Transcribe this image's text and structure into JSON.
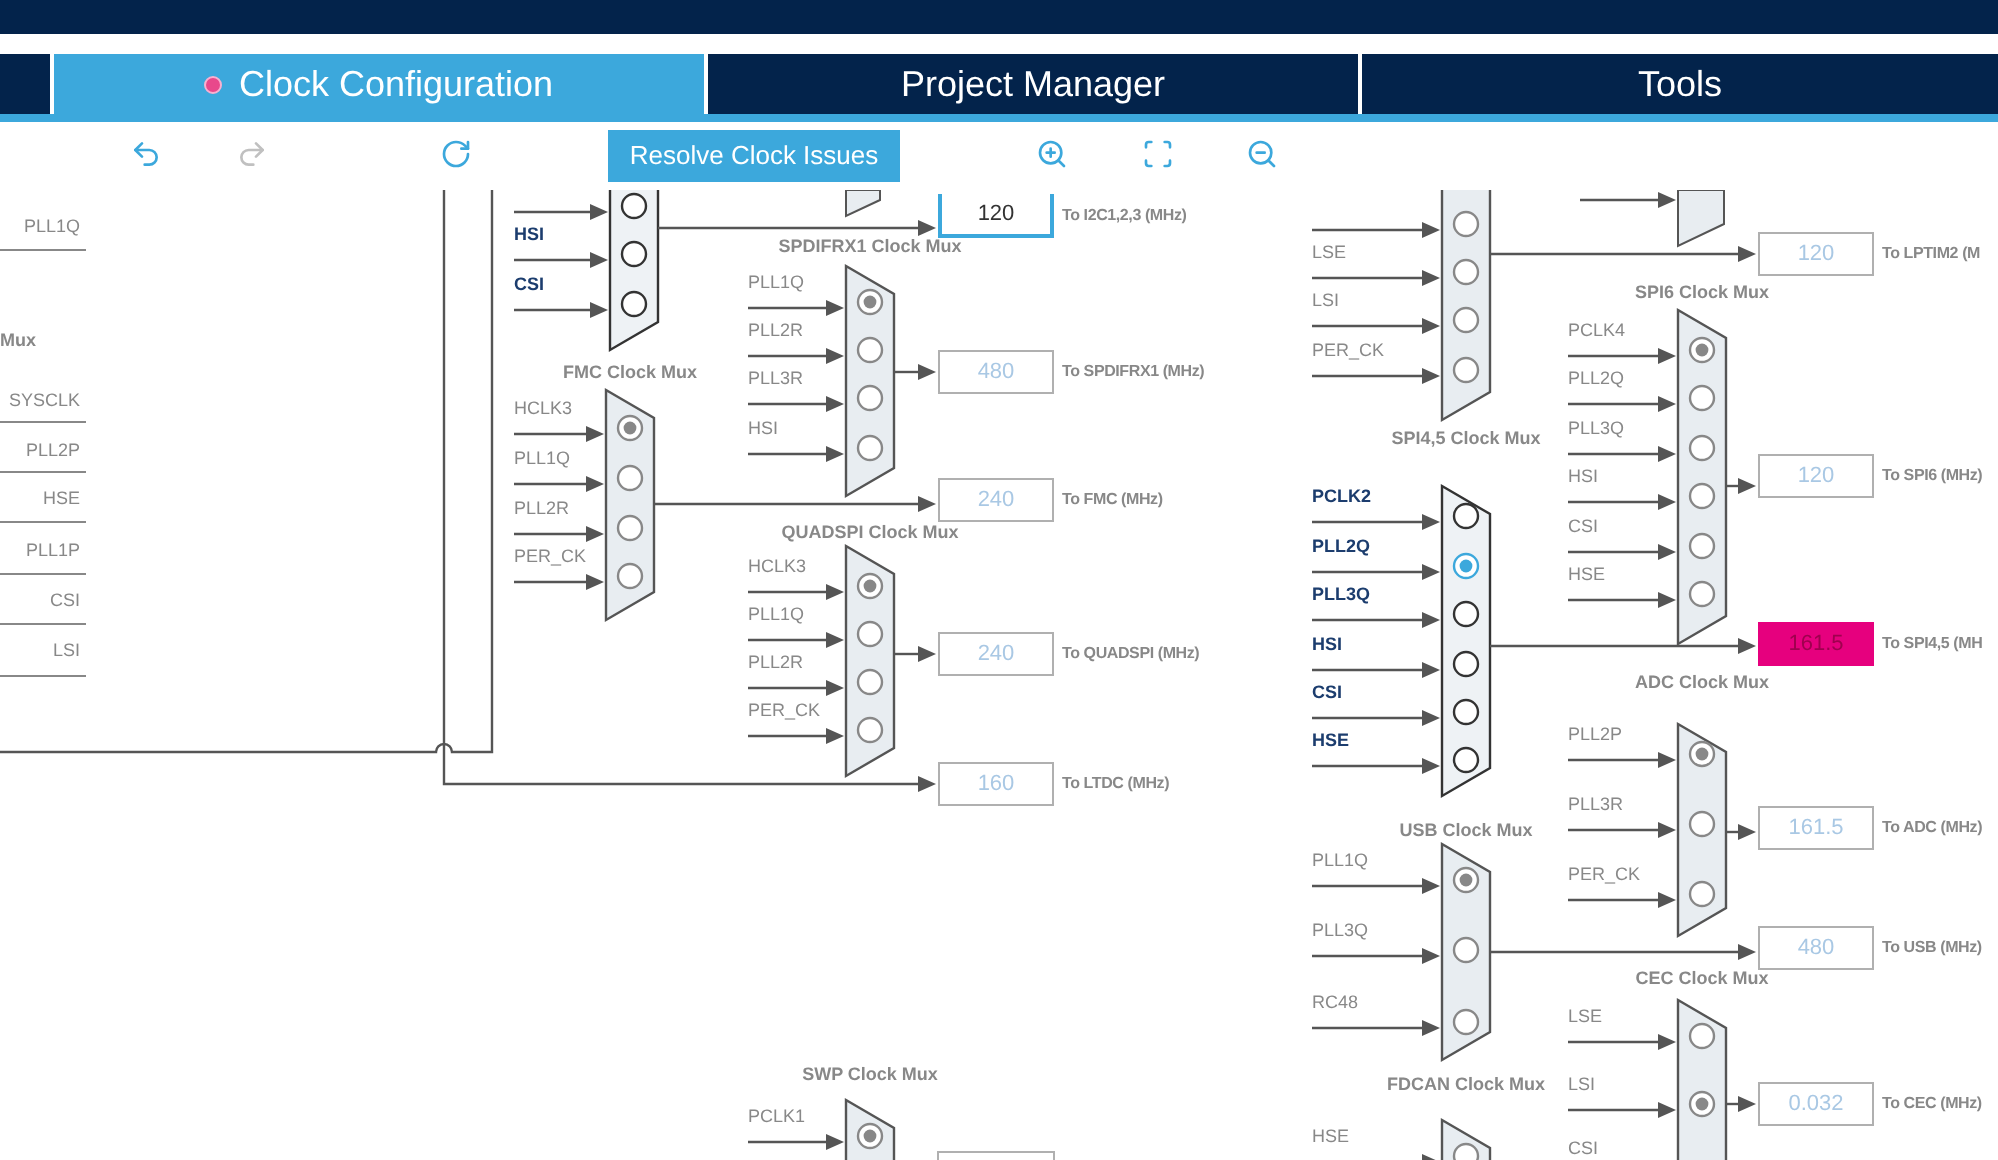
{
  "tabs": [
    {
      "label": "Clock Configuration",
      "selected": true,
      "alert": true
    },
    {
      "label": "Project Manager",
      "selected": false,
      "alert": false
    },
    {
      "label": "Tools",
      "selected": false,
      "alert": false
    }
  ],
  "toolbar": {
    "undo_enabled": true,
    "redo_enabled": false,
    "resolve_button": "Resolve Clock Issues"
  },
  "left_panel": {
    "top_item": "PLL1Q",
    "title": "Mux",
    "items": [
      "SYSCLK",
      "PLL2P",
      "HSE",
      "PLL1P",
      "CSI",
      "LSI"
    ]
  },
  "muxes": [
    {
      "active": true,
      "inputs": [
        {
          "selected": false
        },
        {
          "label": "HSI",
          "selected": false
        },
        {
          "label": "CSI",
          "selected": false
        }
      ]
    },
    {
      "title": "FMC Clock Mux",
      "active": false,
      "inputs": [
        {
          "label": "HCLK3",
          "selected": true
        },
        {
          "label": "PLL1Q",
          "selected": false
        },
        {
          "label": "PLL2R",
          "selected": false
        },
        {
          "label": "PER_CK",
          "selected": false
        }
      ]
    },
    {
      "title": "SPDIFRX1 Clock Mux",
      "active": false,
      "inputs": [
        {
          "label": "PLL1Q",
          "selected": true
        },
        {
          "label": "PLL2R",
          "selected": false
        },
        {
          "label": "PLL3R",
          "selected": false
        },
        {
          "label": "HSI",
          "selected": false
        }
      ]
    },
    {
      "title": "QUADSPI Clock Mux",
      "active": false,
      "inputs": [
        {
          "label": "HCLK3",
          "selected": true
        },
        {
          "label": "PLL1Q",
          "selected": false
        },
        {
          "label": "PLL2R",
          "selected": false
        },
        {
          "label": "PER_CK",
          "selected": false
        }
      ]
    },
    {
      "title": "SWP Clock Mux",
      "active": false,
      "inputs": [
        {
          "label": "PCLK1",
          "selected": true
        }
      ]
    },
    {
      "active": false,
      "inputs": [
        {
          "selected": false
        },
        {
          "label": "LSE",
          "selected": false
        },
        {
          "label": "LSI",
          "selected": false
        },
        {
          "label": "PER_CK",
          "selected": false
        }
      ]
    },
    {
      "title": "SPI6 Clock Mux",
      "active": false,
      "inputs": [
        {
          "label": "PCLK4",
          "selected": true
        },
        {
          "label": "PLL2Q",
          "selected": false
        },
        {
          "label": "PLL3Q",
          "selected": false
        },
        {
          "label": "HSI",
          "selected": false
        },
        {
          "label": "CSI",
          "selected": false
        },
        {
          "label": "HSE",
          "selected": false
        }
      ]
    },
    {
      "title": "SPI4,5 Clock Mux",
      "active": true,
      "inputs": [
        {
          "label": "PCLK2",
          "selected": false
        },
        {
          "label": "PLL2Q",
          "selected": true
        },
        {
          "label": "PLL3Q",
          "selected": false
        },
        {
          "label": "HSI",
          "selected": false
        },
        {
          "label": "CSI",
          "selected": false
        },
        {
          "label": "HSE",
          "selected": false
        }
      ]
    },
    {
      "title": "ADC Clock Mux",
      "active": false,
      "inputs": [
        {
          "label": "PLL2P",
          "selected": true
        },
        {
          "label": "PLL3R",
          "selected": false
        },
        {
          "label": "PER_CK",
          "selected": false
        }
      ]
    },
    {
      "title": "USB Clock Mux",
      "active": false,
      "inputs": [
        {
          "label": "PLL1Q",
          "selected": true
        },
        {
          "label": "PLL3Q",
          "selected": false
        },
        {
          "label": "RC48",
          "selected": false
        }
      ]
    },
    {
      "title": "CEC Clock Mux",
      "active": false,
      "inputs": [
        {
          "label": "LSE",
          "selected": false
        },
        {
          "label": "LSI",
          "selected": true
        },
        {
          "label": "CSI"
        }
      ]
    },
    {
      "title": "FDCAN Clock Mux",
      "active": false,
      "inputs": [
        {
          "label": "HSE",
          "selected": false
        }
      ]
    }
  ],
  "outputs": [
    {
      "value": "120",
      "label": "To I2C1,2,3 (MHz)",
      "kind": "active"
    },
    {
      "value": "480",
      "label": "To SPDIFRX1 (MHz)",
      "kind": "normal"
    },
    {
      "value": "240",
      "label": "To FMC (MHz)",
      "kind": "normal"
    },
    {
      "value": "240",
      "label": "To QUADSPI (MHz)",
      "kind": "normal"
    },
    {
      "value": "160",
      "label": "To LTDC (MHz)",
      "kind": "normal"
    },
    {
      "value": "120",
      "label": "To LPTIM2 (M",
      "kind": "normal"
    },
    {
      "value": "120",
      "label": "To SPI6 (MHz)",
      "kind": "normal"
    },
    {
      "value": "161.5",
      "label": "To SPI4,5 (MH",
      "kind": "error"
    },
    {
      "value": "161.5",
      "label": "To ADC (MHz)",
      "kind": "normal"
    },
    {
      "value": "480",
      "label": "To USB (MHz)",
      "kind": "normal"
    },
    {
      "value": "0.032",
      "label": "To CEC (MHz)",
      "kind": "normal"
    }
  ]
}
